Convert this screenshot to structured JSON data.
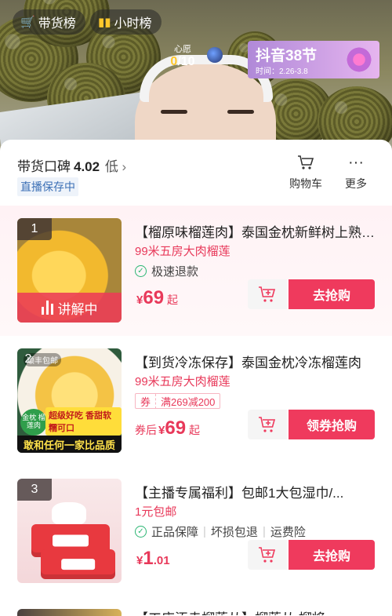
{
  "video": {
    "sales_rank": "带货榜",
    "hourly_rank": "小时榜",
    "wish_label": "心愿",
    "wish_current": "0",
    "wish_total": "/10",
    "festival_title": "抖音38节",
    "festival_time": "时间：2.26-3.8"
  },
  "panel": {
    "reputation_label": "带货口碑",
    "reputation_score": "4.02",
    "reputation_level": "低",
    "saving_tag": "直播保存中",
    "cart_label": "购物车",
    "more_label": "更多"
  },
  "products": [
    {
      "index": "1",
      "explaining": "讲解中",
      "title": "【榴原味榴莲肉】泰国金枕新鲜树上熟冷冻榴莲",
      "subtitle": "99米五房大肉榴莲",
      "feature": "极速退款",
      "price_prefix": "",
      "price_currency": "¥",
      "price_int": "69",
      "price_dec": "",
      "price_suffix": "起",
      "buy_label": "去抢购"
    },
    {
      "index": "2",
      "brand_badge": "顺丰包邮",
      "promo_badge_1": "金枕 榴莲肉",
      "promo_badge_2": "超级好吃 香甜软糯可口",
      "promo_strip": "敢和任何一家比品质",
      "title": "【到货冷冻保存】泰国金枕冷冻榴莲肉",
      "subtitle": "99米五房大肉榴莲",
      "coupon_left": "券",
      "coupon_right": "满269减200",
      "price_prefix": "券后",
      "price_currency": "¥",
      "price_int": "69",
      "price_dec": "",
      "price_suffix": "起",
      "buy_label": "领券抢购"
    },
    {
      "index": "3",
      "title": "【主播专属福利】包邮1大包湿巾/...",
      "subtitle": "1元包邮",
      "features": [
        "正品保障",
        "坏损包退",
        "运费险"
      ],
      "price_prefix": "",
      "price_currency": "¥",
      "price_int": "1",
      "price_dec": ".01",
      "price_suffix": "",
      "buy_label": "去抢购"
    }
  ],
  "peek_title": "【工店添走榴莲从】榴莲从 榴将"
}
